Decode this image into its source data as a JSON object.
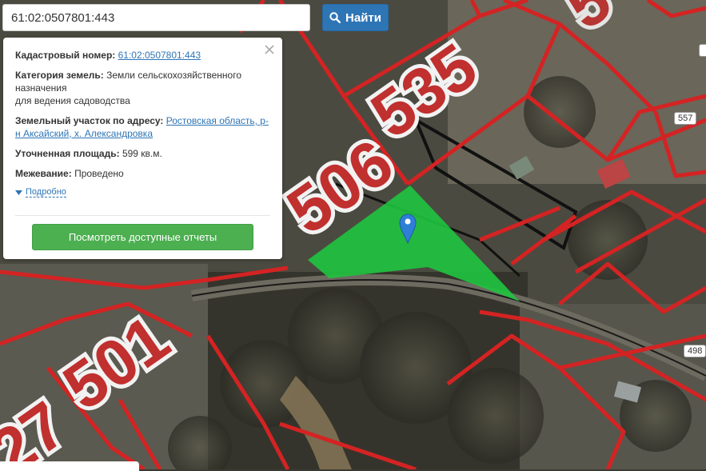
{
  "search": {
    "value": "61:02:0507801:443",
    "button_label": "Найти"
  },
  "info": {
    "cadastral_label": "Кадастровый номер:",
    "cadastral_value": "61:02:0507801:443",
    "category_label": "Категория земель:",
    "category_value": "Земли сельскохозяйственного назначения",
    "category_value_2": "для ведения садоводства",
    "address_label": "Земельный участок по адресу:",
    "address_value_1": "Ростовская область, р-",
    "address_value_2": "н Аксайский, х. Александровка",
    "area_label": "Уточненная площадь:",
    "area_value": "599 кв.м.",
    "survey_label": "Межевание:",
    "survey_value": "Проведено",
    "details_link": "Подробно",
    "reports_button": "Посмотреть доступные отчеты"
  },
  "map": {
    "plot_numbers": [
      "535",
      "506",
      "501",
      "27"
    ],
    "road_badges": [
      "557",
      "498"
    ],
    "highlight_color": "#1fc43f",
    "boundary_color": "#d42323"
  }
}
